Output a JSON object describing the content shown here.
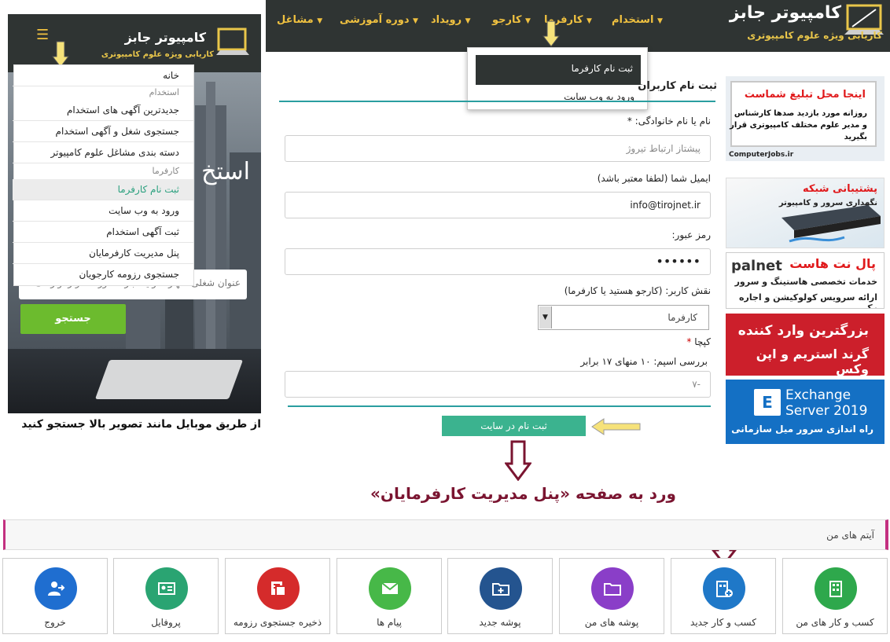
{
  "site": {
    "logo_title": "کامپیوتر جابز",
    "logo_sub": "کاریابی ویژه علوم کامپیوتری"
  },
  "nav": [
    {
      "label": "استخدام"
    },
    {
      "label": "کارفرما"
    },
    {
      "label": "کارجو"
    },
    {
      "label": "رویداد"
    },
    {
      "label": "دوره آموزشی"
    },
    {
      "label": "مشاغل"
    }
  ],
  "dropdown": {
    "active": "ثبت نام کارفرما",
    "login": "ورود به وب سایت"
  },
  "mobile": {
    "hero": "استخ نویس و",
    "search_placeholder": "عنوان شغلی، مهارت و یا عبارت مورد نظر را وارد ک",
    "search_button": "جستجو",
    "menu": [
      {
        "label": "خانه",
        "type": "item"
      },
      {
        "label": "استخدام",
        "type": "group"
      },
      {
        "label": "جدیدترین آگهی های استخدام",
        "type": "item"
      },
      {
        "label": "جستجوی شغل و آگهی استخدام",
        "type": "item"
      },
      {
        "label": "دسته بندی مشاغل علوم کامپیوتر",
        "type": "item"
      },
      {
        "label": "کارفرما",
        "type": "group"
      },
      {
        "label": "ثبت نام کارفرما",
        "type": "active"
      },
      {
        "label": "ورود به وب سایت",
        "type": "item"
      },
      {
        "label": "ثبت آگهی استخدام",
        "type": "item"
      },
      {
        "label": "پنل مدیریت کارفرمایان",
        "type": "item"
      },
      {
        "label": "جستجوی رزومه کارجویان",
        "type": "item"
      }
    ],
    "caption": "از طریق موبایل مانند تصویر بالا جستجو کنید"
  },
  "form": {
    "title": "ثبت نام کاربران",
    "name_label": "نام یا نام خانوادگی:",
    "name_value": "پیشتاز ارتباط تیروژ",
    "email_label": "ایمیل شما (لطفا معتبر باشد)",
    "email_value": "info@tirojnet.ir",
    "password_label": "رمز عبور:",
    "password_value": "••••••",
    "role_label": "نقش کاربر: (کارجو هستید یا کارفرما)",
    "role_value": "کارفرما",
    "captcha_label": "کپچا",
    "captcha_question": "بررسی اسپم: ۱۰ منهای ۱۷ برابر",
    "captcha_value": "-۷",
    "submit": "ثبت نام در سایت",
    "required_mark": "*"
  },
  "instruction": "ورد به صفحه «پنل مدیریت کارفرمایان»",
  "ads": {
    "ad1_title": "اینجا محل تبلیغ شماست",
    "ad1_text": "روزانه مورد بازدید صدها کارشناس و مدیر علوم مختلف کامپیوتری قرار بگیرید",
    "ad1_footer": "ComputerJobs.ir",
    "ad2_title": "پشتیبانی شبکه",
    "ad2_text": "نگهداری سرور و کامپیوتر",
    "ad3_logo": "palnet",
    "ad3_title": "پال نت هاست",
    "ad3_line1": "خدمات تخصصی هاستینگ و سرور",
    "ad3_line2": "ارائه سرویس کولوکیشن و اجاره رک",
    "ad4_line1": "بزرگترین وارد کننده",
    "ad4_line2": "گرند استریم و اپن وکس",
    "ad5_line1": "Exchange",
    "ad5_line2": "Server 2019",
    "ad5_icon": "E",
    "ad5_text": "راه اندازی سرور میل سازمانی"
  },
  "items_bar": {
    "title": "آیتم های من"
  },
  "tiles": [
    {
      "label": "کسب و کار های من",
      "color": "#2ea84c",
      "icon": "building-icon"
    },
    {
      "label": "کسب و کار جدید",
      "color": "#1f78c8",
      "icon": "building-add-icon"
    },
    {
      "label": "پوشه های من",
      "color": "#8a3ec8",
      "icon": "folder-icon"
    },
    {
      "label": "پوشه جدید",
      "color": "#24548f",
      "icon": "folder-add-icon"
    },
    {
      "label": "پیام ها",
      "color": "#47b848",
      "icon": "envelope-icon"
    },
    {
      "label": "ذخیره جستجوی رزومه",
      "color": "#d52b2b",
      "icon": "save-search-icon"
    },
    {
      "label": "پروفایل",
      "color": "#2aa472",
      "icon": "id-card-icon"
    },
    {
      "label": "خروج",
      "color": "#1f6ed0",
      "icon": "logout-icon"
    }
  ]
}
